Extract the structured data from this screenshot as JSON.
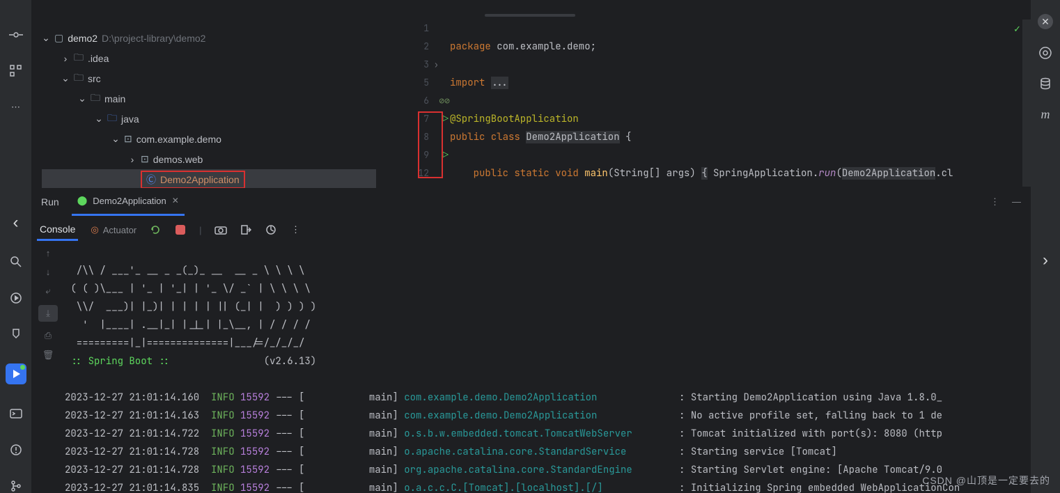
{
  "tree": {
    "project_name": "demo2",
    "project_path": "D:\\project-library\\demo2",
    "idea": ".idea",
    "src": "src",
    "main": "main",
    "java": "java",
    "package": "com.example.demo",
    "subpkg": "demos.web",
    "class": "Demo2Application"
  },
  "editor": {
    "lines": [
      "1",
      "2",
      "3",
      "5",
      "6",
      "7",
      "8",
      "9",
      "12"
    ],
    "l1_kw": "package ",
    "l1_pkg": "com.example.demo;",
    "l3_kw": "import ",
    "l3_rest": "...",
    "l6_ann": "@SpringBootApplication",
    "l7_kw1": "public class ",
    "l7_cls": "Demo2Application",
    "l7_brace": " {",
    "l9a": "    public static void ",
    "l9m": "main",
    "l9b": "(String[] args) ",
    "l9br": "{",
    "l9sp": " SpringApplication.",
    "l9run": "run",
    "l9c": "(",
    "l9cls": "Demo2Application",
    "l9d": ".cl"
  },
  "run": {
    "title": "Run",
    "tab": "Demo2Application",
    "console": "Console",
    "actuator": "Actuator"
  },
  "banner": [
    "  /\\\\ / ___'_ __ _ _(_)_ __  __ _ \\ \\ \\ \\",
    " ( ( )\\___ | '_ | '_| | '_ \\/ _` | \\ \\ \\ \\",
    "  \\\\/  ___)| |_)| | | | | || (_| |  ) ) ) )",
    "   '  |____| .__|_| |_|_| |_\\__, | / / / /",
    "  =========|_|==============|___/=/_/_/_/"
  ],
  "boot_label": " :: Spring Boot :: ",
  "boot_version": "(v2.6.13)",
  "logs": [
    {
      "ts": "2023-12-27 21:01:14.160",
      "lvl": "INFO",
      "pid": "15592",
      "thr": "main",
      "logger": "com.example.demo.Demo2Application",
      "msg": "Starting Demo2Application using Java 1.8.0_"
    },
    {
      "ts": "2023-12-27 21:01:14.163",
      "lvl": "INFO",
      "pid": "15592",
      "thr": "main",
      "logger": "com.example.demo.Demo2Application",
      "msg": "No active profile set, falling back to 1 de"
    },
    {
      "ts": "2023-12-27 21:01:14.722",
      "lvl": "INFO",
      "pid": "15592",
      "thr": "main",
      "logger": "o.s.b.w.embedded.tomcat.TomcatWebServer",
      "msg": "Tomcat initialized with port(s): 8080 (http"
    },
    {
      "ts": "2023-12-27 21:01:14.728",
      "lvl": "INFO",
      "pid": "15592",
      "thr": "main",
      "logger": "o.apache.catalina.core.StandardService",
      "msg": "Starting service [Tomcat]"
    },
    {
      "ts": "2023-12-27 21:01:14.728",
      "lvl": "INFO",
      "pid": "15592",
      "thr": "main",
      "logger": "org.apache.catalina.core.StandardEngine",
      "msg": "Starting Servlet engine: [Apache Tomcat/9.0"
    },
    {
      "ts": "2023-12-27 21:01:14.835",
      "lvl": "INFO",
      "pid": "15592",
      "thr": "main",
      "logger": "o.a.c.c.C.[Tomcat].[localhost].[/]",
      "msg": "Initializing Spring embedded WebApplicationCon"
    }
  ],
  "watermark": "CSDN @山顶是一定要去的"
}
